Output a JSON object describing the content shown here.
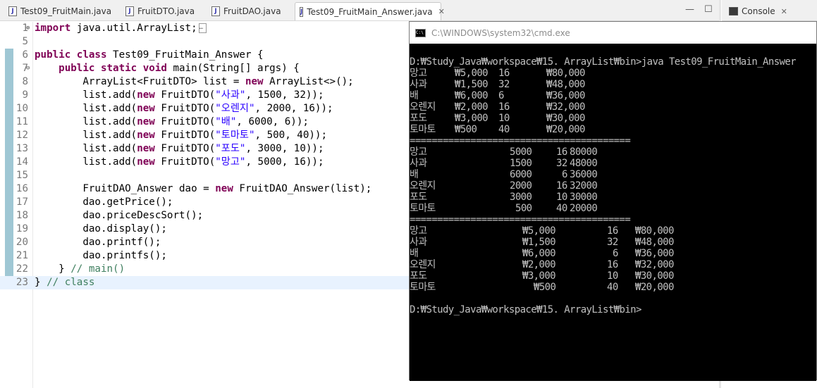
{
  "tabs": [
    {
      "label": "Test09_FruitMain.java",
      "active": false,
      "icon": "java-file-icon"
    },
    {
      "label": "FruitDTO.java",
      "active": false,
      "icon": "java-file-icon"
    },
    {
      "label": "FruitDAO.java",
      "active": false,
      "icon": "java-file-icon"
    },
    {
      "label": "Test09_FruitMain_Answer.java",
      "active": true,
      "icon": "java-file-icon",
      "close": "✕"
    }
  ],
  "window_controls": {
    "minimize": "—",
    "maximize": "☐"
  },
  "console": {
    "label": "Console",
    "close": "✕"
  },
  "editor": {
    "lines": [
      {
        "n": "1",
        "html": "<span class=\"kw\">import</span> java.util.ArrayList;",
        "fold": "⊕",
        "collapsed": true
      },
      {
        "n": "5",
        "html": ""
      },
      {
        "n": "6",
        "html": "<span class=\"kw\">public</span> <span class=\"kw\">class</span> Test09_FruitMain_Answer {"
      },
      {
        "n": "7",
        "html": "    <span class=\"kw\">public</span> <span class=\"kw\">static</span> <span class=\"kw\">void</span> main(String[] args) {",
        "fold": "⊖"
      },
      {
        "n": "8",
        "html": "        ArrayList&lt;FruitDTO&gt; list = <span class=\"kw\">new</span> ArrayList&lt;&gt;();"
      },
      {
        "n": "9",
        "html": "        list.add(<span class=\"kw\">new</span> FruitDTO(<span class=\"str\">\"사과\"</span>, 1500, 32));"
      },
      {
        "n": "10",
        "html": "        list.add(<span class=\"kw\">new</span> FruitDTO(<span class=\"str\">\"오렌지\"</span>, 2000, 16));"
      },
      {
        "n": "11",
        "html": "        list.add(<span class=\"kw\">new</span> FruitDTO(<span class=\"str\">\"배\"</span>, 6000, 6));"
      },
      {
        "n": "12",
        "html": "        list.add(<span class=\"kw\">new</span> FruitDTO(<span class=\"str\">\"토마토\"</span>, 500, 40));"
      },
      {
        "n": "13",
        "html": "        list.add(<span class=\"kw\">new</span> FruitDTO(<span class=\"str\">\"포도\"</span>, 3000, 10));"
      },
      {
        "n": "14",
        "html": "        list.add(<span class=\"kw\">new</span> FruitDTO(<span class=\"str\">\"망고\"</span>, 5000, 16));"
      },
      {
        "n": "15",
        "html": ""
      },
      {
        "n": "16",
        "html": "        FruitDAO_Answer dao = <span class=\"kw\">new</span> FruitDAO_Answer(list);"
      },
      {
        "n": "17",
        "html": "        dao.getPrice();"
      },
      {
        "n": "18",
        "html": "        dao.priceDescSort();"
      },
      {
        "n": "19",
        "html": "        dao.display();"
      },
      {
        "n": "20",
        "html": "        dao.printf();"
      },
      {
        "n": "21",
        "html": "        dao.printfs();"
      },
      {
        "n": "22",
        "html": "    } <span class=\"cmt\">// main()</span>"
      },
      {
        "n": "23",
        "html": "} <span class=\"cmt\">// class</span>",
        "current": true
      }
    ]
  },
  "cmd": {
    "title": "C:\\WINDOWS\\system32\\cmd.exe",
    "icon_text": "C:\\",
    "lines": [
      [
        ""
      ],
      [
        [
          0,
          "D:₩Study_Java₩workspace₩15. ArrayList₩bin>java Test09_FruitMain_Answer"
        ]
      ],
      [
        [
          0,
          "망고"
        ],
        [
          64,
          "₩5,000"
        ],
        [
          126,
          "16"
        ],
        [
          194,
          "₩80,000"
        ]
      ],
      [
        [
          0,
          "사과"
        ],
        [
          64,
          "₩1,500"
        ],
        [
          126,
          "32"
        ],
        [
          194,
          "₩48,000"
        ]
      ],
      [
        [
          0,
          "배"
        ],
        [
          64,
          "₩6,000"
        ],
        [
          126,
          "6"
        ],
        [
          194,
          "₩36,000"
        ]
      ],
      [
        [
          0,
          "오렌지"
        ],
        [
          64,
          "₩2,000"
        ],
        [
          126,
          "16"
        ],
        [
          194,
          "₩32,000"
        ]
      ],
      [
        [
          0,
          "포도"
        ],
        [
          64,
          "₩3,000"
        ],
        [
          126,
          "10"
        ],
        [
          194,
          "₩30,000"
        ]
      ],
      [
        [
          0,
          "토마토"
        ],
        [
          64,
          "₩500"
        ],
        [
          126,
          "40"
        ],
        [
          194,
          "₩20,000"
        ]
      ],
      [
        [
          0,
          "========================================"
        ]
      ],
      [
        [
          0,
          "망고"
        ],
        [
          142,
          "5000"
        ],
        [
          208,
          "16"
        ],
        [
          227,
          "80000"
        ]
      ],
      [
        [
          0,
          "사과"
        ],
        [
          142,
          "1500"
        ],
        [
          208,
          "32"
        ],
        [
          227,
          "48000"
        ]
      ],
      [
        [
          0,
          "배"
        ],
        [
          142,
          "6000"
        ],
        [
          216,
          "6"
        ],
        [
          227,
          "36000"
        ]
      ],
      [
        [
          0,
          "오렌지"
        ],
        [
          142,
          "2000"
        ],
        [
          208,
          "16"
        ],
        [
          227,
          "32000"
        ]
      ],
      [
        [
          0,
          "포도"
        ],
        [
          142,
          "3000"
        ],
        [
          208,
          "10"
        ],
        [
          227,
          "30000"
        ]
      ],
      [
        [
          0,
          "토마토"
        ],
        [
          150,
          "500"
        ],
        [
          208,
          "40"
        ],
        [
          227,
          "20000"
        ]
      ],
      [
        [
          0,
          "========================================"
        ]
      ],
      [
        [
          0,
          "망고"
        ],
        [
          160,
          "₩5,000"
        ],
        [
          280,
          "16"
        ],
        [
          320,
          "₩80,000"
        ]
      ],
      [
        [
          0,
          "사과"
        ],
        [
          160,
          "₩1,500"
        ],
        [
          280,
          "32"
        ],
        [
          320,
          "₩48,000"
        ]
      ],
      [
        [
          0,
          "배"
        ],
        [
          160,
          "₩6,000"
        ],
        [
          288,
          "6"
        ],
        [
          320,
          "₩36,000"
        ]
      ],
      [
        [
          0,
          "오렌지"
        ],
        [
          160,
          "₩2,000"
        ],
        [
          280,
          "16"
        ],
        [
          320,
          "₩32,000"
        ]
      ],
      [
        [
          0,
          "포도"
        ],
        [
          160,
          "₩3,000"
        ],
        [
          280,
          "10"
        ],
        [
          320,
          "₩30,000"
        ]
      ],
      [
        [
          0,
          "토마토"
        ],
        [
          176,
          "₩500"
        ],
        [
          280,
          "40"
        ],
        [
          320,
          "₩20,000"
        ]
      ],
      [
        ""
      ],
      [
        [
          0,
          "D:₩Study_Java₩workspace₩15. ArrayList₩bin>"
        ]
      ]
    ]
  }
}
